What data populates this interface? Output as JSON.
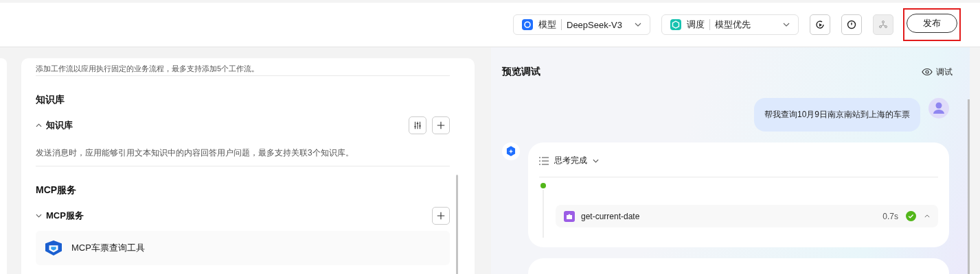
{
  "toolbar": {
    "model": {
      "label": "模型",
      "value": "DeepSeek-V3"
    },
    "schedule": {
      "label": "调度",
      "value": "模型优先"
    },
    "publish_button": "发布"
  },
  "config": {
    "workflow_hint": "添加工作流以应用执行固定的业务流程，最多支持添加5个工作流。",
    "sections": [
      {
        "title": "知识库",
        "group": {
          "label": "知识库",
          "expanded": true,
          "settings": true
        },
        "hint": "发送消息时，应用能够引用文本知识中的内容回答用户问题，最多支持关联3个知识库。"
      },
      {
        "title": "MCP服务",
        "group": {
          "label": "MCP服务",
          "expanded": false,
          "settings": false
        },
        "items": [
          {
            "name": "MCP车票查询工具"
          }
        ]
      }
    ]
  },
  "preview": {
    "title": "预览调试",
    "debug_button": "调试",
    "messages": [
      {
        "kind": "user",
        "text": "帮我查询10月9日南京南站到上海的车票"
      },
      {
        "kind": "assistant",
        "status": "思考完成",
        "tool_calls": [
          {
            "name": "get-current-date",
            "time": "0.7s",
            "success": true
          }
        ]
      }
    ]
  }
}
